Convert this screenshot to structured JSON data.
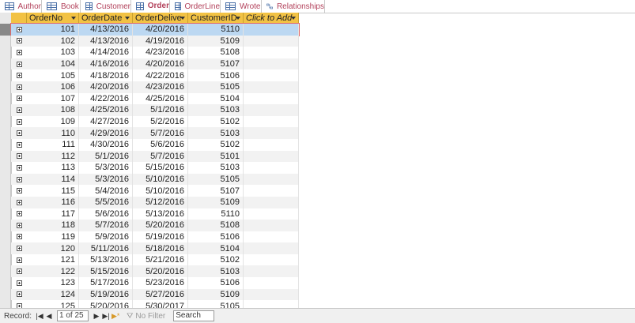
{
  "tabs": [
    {
      "label": "Author",
      "icon": "table-icon"
    },
    {
      "label": "Book",
      "icon": "table-icon"
    },
    {
      "label": "Customer",
      "icon": "table-icon"
    },
    {
      "label": "Order",
      "icon": "table-icon",
      "active": true
    },
    {
      "label": "OrderLine",
      "icon": "table-icon"
    },
    {
      "label": "Wrote",
      "icon": "table-icon"
    },
    {
      "label": "Relationships",
      "icon": "relationships-icon"
    }
  ],
  "grid": {
    "columns": [
      "OrderNo",
      "OrderDate",
      "OrderDelive",
      "CustomerID",
      "Click to Add"
    ],
    "rows": [
      [
        "101",
        "4/13/2016",
        "4/20/2016",
        "5110"
      ],
      [
        "102",
        "4/13/2016",
        "4/19/2016",
        "5109"
      ],
      [
        "103",
        "4/14/2016",
        "4/23/2016",
        "5108"
      ],
      [
        "104",
        "4/16/2016",
        "4/20/2016",
        "5107"
      ],
      [
        "105",
        "4/18/2016",
        "4/22/2016",
        "5106"
      ],
      [
        "106",
        "4/20/2016",
        "4/23/2016",
        "5105"
      ],
      [
        "107",
        "4/22/2016",
        "4/25/2016",
        "5104"
      ],
      [
        "108",
        "4/25/2016",
        "5/1/2016",
        "5103"
      ],
      [
        "109",
        "4/27/2016",
        "5/2/2016",
        "5102"
      ],
      [
        "110",
        "4/29/2016",
        "5/7/2016",
        "5103"
      ],
      [
        "111",
        "4/30/2016",
        "5/6/2016",
        "5102"
      ],
      [
        "112",
        "5/1/2016",
        "5/7/2016",
        "5101"
      ],
      [
        "113",
        "5/3/2016",
        "5/15/2016",
        "5103"
      ],
      [
        "114",
        "5/3/2016",
        "5/10/2016",
        "5105"
      ],
      [
        "115",
        "5/4/2016",
        "5/10/2016",
        "5107"
      ],
      [
        "116",
        "5/5/2016",
        "5/12/2016",
        "5109"
      ],
      [
        "117",
        "5/6/2016",
        "5/13/2016",
        "5110"
      ],
      [
        "118",
        "5/7/2016",
        "5/20/2016",
        "5108"
      ],
      [
        "119",
        "5/9/2016",
        "5/19/2016",
        "5106"
      ],
      [
        "120",
        "5/11/2016",
        "5/18/2016",
        "5104"
      ],
      [
        "121",
        "5/13/2016",
        "5/21/2016",
        "5102"
      ],
      [
        "122",
        "5/15/2016",
        "5/20/2016",
        "5103"
      ],
      [
        "123",
        "5/17/2016",
        "5/23/2016",
        "5106"
      ],
      [
        "124",
        "5/19/2016",
        "5/27/2016",
        "5109"
      ],
      [
        "125",
        "5/20/2016",
        "5/30/2017",
        "5105"
      ]
    ],
    "current_row": 0
  },
  "status": {
    "record_label": "Record:",
    "record_position": "1 of 25",
    "filter_label": "No Filter",
    "search_label": "Search"
  },
  "colors": {
    "tab_text": "#b2405a",
    "header_bg": "#f2c244",
    "selected_row": "#bcd8f2"
  }
}
